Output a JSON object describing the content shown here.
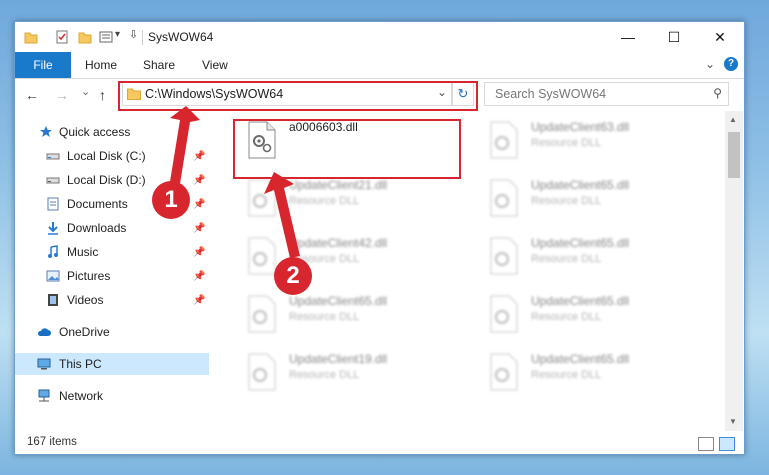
{
  "window": {
    "title": "SysWOW64",
    "minimize_glyph": "—",
    "maximize_glyph": "☐",
    "close_glyph": "✕"
  },
  "ribbon": {
    "file_tab": "File",
    "tabs": [
      "Home",
      "Share",
      "View"
    ],
    "expand_glyph": "⌄",
    "help_glyph": "?"
  },
  "nav": {
    "back_glyph": "←",
    "forward_glyph": "→",
    "history_glyph": "⌄",
    "up_glyph": "↑",
    "address": "C:\\Windows\\SysWOW64",
    "address_dropdown_glyph": "⌄",
    "refresh_glyph": "↻",
    "search_placeholder": "Search SysWOW64",
    "search_glyph": "⚲"
  },
  "sidebar": {
    "items": [
      {
        "label": "Quick access",
        "icon": "star-icon",
        "pinned": false
      },
      {
        "label": "Local Disk (C:)",
        "icon": "drive-icon",
        "pinned": true
      },
      {
        "label": "Local Disk (D:)",
        "icon": "drive-icon",
        "pinned": true
      },
      {
        "label": "Documents",
        "icon": "documents-icon",
        "pinned": true
      },
      {
        "label": "Downloads",
        "icon": "downloads-icon",
        "pinned": true
      },
      {
        "label": "Music",
        "icon": "music-icon",
        "pinned": true
      },
      {
        "label": "Pictures",
        "icon": "pictures-icon",
        "pinned": true
      },
      {
        "label": "Videos",
        "icon": "videos-icon",
        "pinned": true
      },
      {
        "label": "OneDrive",
        "icon": "cloud-icon",
        "pinned": false
      },
      {
        "label": "This PC",
        "icon": "computer-icon",
        "pinned": false,
        "selected": true
      },
      {
        "label": "Network",
        "icon": "network-icon",
        "pinned": false
      }
    ],
    "pin_glyph": "📌"
  },
  "files": {
    "highlighted": {
      "name": "a0006603.dll",
      "type": ""
    },
    "blurred": [
      {
        "name": "UpdateClient63.dll",
        "type": "Resource DLL"
      },
      {
        "name": "UpdateClient21.dll",
        "type": "Resource DLL"
      },
      {
        "name": "UpdateClient65.dll",
        "type": "Resource DLL"
      },
      {
        "name": "UpdateClient42.dll",
        "type": "Resource DLL"
      },
      {
        "name": "UpdateClient65.dll",
        "type": "Resource DLL"
      },
      {
        "name": "UpdateClient65.dll",
        "type": "Resource DLL"
      },
      {
        "name": "UpdateClient65.dll",
        "type": "Resource DLL"
      },
      {
        "name": "UpdateClient19.dll",
        "type": "Resource DLL"
      },
      {
        "name": "UpdateClient65.dll",
        "type": "Resource DLL"
      }
    ]
  },
  "status": {
    "item_count": "167 items"
  },
  "annotations": {
    "marker_1": "1",
    "marker_2": "2",
    "color": "#d7262e"
  },
  "colors": {
    "accent": "#1979ca",
    "selected_bg": "#cce8ff"
  }
}
